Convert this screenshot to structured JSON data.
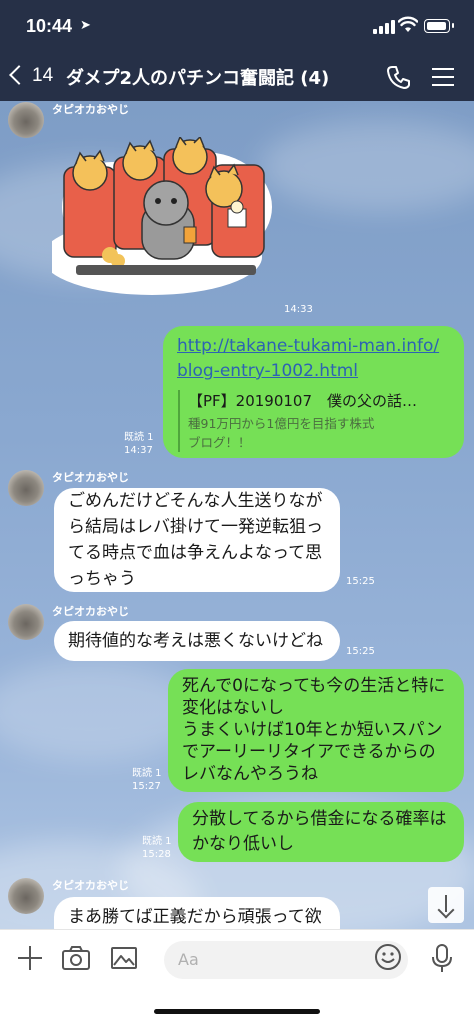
{
  "status": {
    "time": "10:44"
  },
  "header": {
    "back_count": "14",
    "title": "ダメプ2人のパチンコ奮闘記 (4)"
  },
  "contact": {
    "name": "タピオカおやじ"
  },
  "messages": {
    "m1": {
      "time": "14:33"
    },
    "m2": {
      "url_line1": "http://takane-tukami-man.info/",
      "url_line2": "blog-entry-1002.html",
      "preview_title": "【PF】20190107　僕の父の話…",
      "preview_desc_line1": "種91万円から1億円を目指す株式",
      "preview_desc_line2": "ブログ！！",
      "read": "既読 1",
      "time": "14:37"
    },
    "m3": {
      "line1": "ごめんだけどそんな人生送りなが",
      "line2": "ら結局はレバ掛けて一発逆転狙っ",
      "line3": "てる時点で血は争えんよなって思",
      "line4": "っちゃう",
      "time": "15:25"
    },
    "m4": {
      "text": "期待値的な考えは悪くないけどね",
      "time": "15:25"
    },
    "m5": {
      "line1": "死んで0になっても今の生活と特に",
      "line2": "変化はないし",
      "line3": "うまくいけば10年とか短いスパン",
      "line4": "でアーリーリタイアできるからの",
      "line5": "レバなんやろうね",
      "read": "既読 1",
      "time": "15:27"
    },
    "m6": {
      "line1": "分散してるから借金になる確率は",
      "line2": "かなり低いし",
      "read": "既読 1",
      "time": "15:28"
    },
    "m7": {
      "text": "まあ勝てば正義だから頑張って欲"
    }
  },
  "input": {
    "placeholder": "Aa"
  },
  "icons": {
    "back": "chevron-left-icon",
    "call": "phone-icon",
    "menu": "hamburger-menu-icon",
    "scroll": "arrow-down-icon",
    "add": "plus-icon",
    "camera": "camera-icon",
    "image": "image-icon",
    "emoji": "emoji-icon",
    "mic": "microphone-icon"
  },
  "colors": {
    "header": "#263047",
    "bubble_out": "#76e056",
    "bubble_in": "#ffffff",
    "link": "#2d63b3"
  }
}
